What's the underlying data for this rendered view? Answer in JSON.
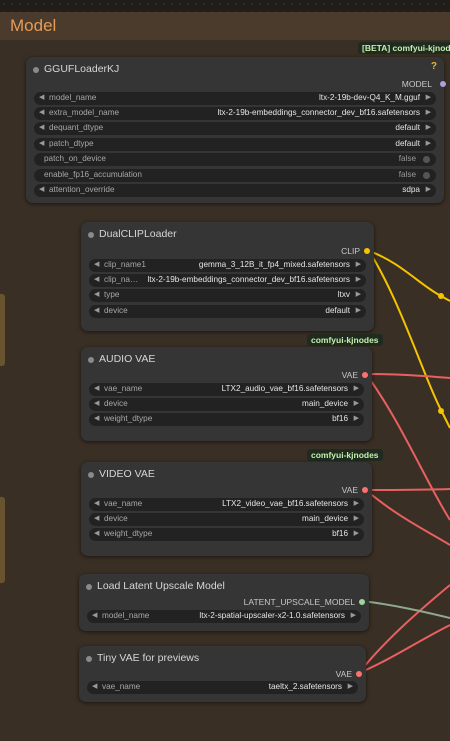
{
  "group": {
    "title": "Model"
  },
  "badges": {
    "beta": "[BETA] comfyui-kjnodes",
    "kj1": "comfyui-kjnodes",
    "kj2": "comfyui-kjnodes"
  },
  "colors": {
    "clip": "#f5c400",
    "vae": "#ff7070",
    "latent_upscale": "#9dd49d",
    "model": "#b39ddb",
    "group": "#3a2f24"
  },
  "nodes": {
    "gguf": {
      "title": "GGUFLoaderKJ",
      "help": "?",
      "output": "MODEL",
      "widgets": [
        {
          "label": "model_name",
          "value": "ltx-2-19b-dev-Q4_K_M.gguf"
        },
        {
          "label": "extra_model_name",
          "value": "ltx-2-19b-embeddings_connector_dev_bf16.safetensors"
        },
        {
          "label": "dequant_dtype",
          "value": "default"
        },
        {
          "label": "patch_dtype",
          "value": "default"
        },
        {
          "label": "patch_on_device",
          "value": "false"
        },
        {
          "label": "enable_fp16_accumulation",
          "value": "false"
        },
        {
          "label": "attention_override",
          "value": "sdpa"
        }
      ]
    },
    "dualclip": {
      "title": "DualCLIPLoader",
      "output": "CLIP",
      "widgets": [
        {
          "label": "clip_name1",
          "value": "gemma_3_12B_it_fp4_mixed.safetensors"
        },
        {
          "label": "clip_na…",
          "value": "ltx-2-19b-embeddings_connector_dev_bf16.safetensors"
        },
        {
          "label": "type",
          "value": "ltxv"
        },
        {
          "label": "device",
          "value": "default"
        }
      ]
    },
    "audio_vae": {
      "title": "AUDIO VAE",
      "output": "VAE",
      "widgets": [
        {
          "label": "vae_name",
          "value": "LTX2_audio_vae_bf16.safetensors"
        },
        {
          "label": "device",
          "value": "main_device"
        },
        {
          "label": "weight_dtype",
          "value": "bf16"
        }
      ]
    },
    "video_vae": {
      "title": "VIDEO VAE",
      "output": "VAE",
      "widgets": [
        {
          "label": "vae_name",
          "value": "LTX2_video_vae_bf16.safetensors"
        },
        {
          "label": "device",
          "value": "main_device"
        },
        {
          "label": "weight_dtype",
          "value": "bf16"
        }
      ]
    },
    "latent_upscale": {
      "title": "Load Latent Upscale Model",
      "output": "LATENT_UPSCALE_MODEL",
      "widgets": [
        {
          "label": "model_name",
          "value": "ltx-2-spatial-upscaler-x2-1.0.safetensors"
        }
      ]
    },
    "tiny_vae": {
      "title": "Tiny VAE for previews",
      "output": "VAE",
      "widgets": [
        {
          "label": "vae_name",
          "value": "taeltx_2.safetensors"
        }
      ]
    }
  }
}
